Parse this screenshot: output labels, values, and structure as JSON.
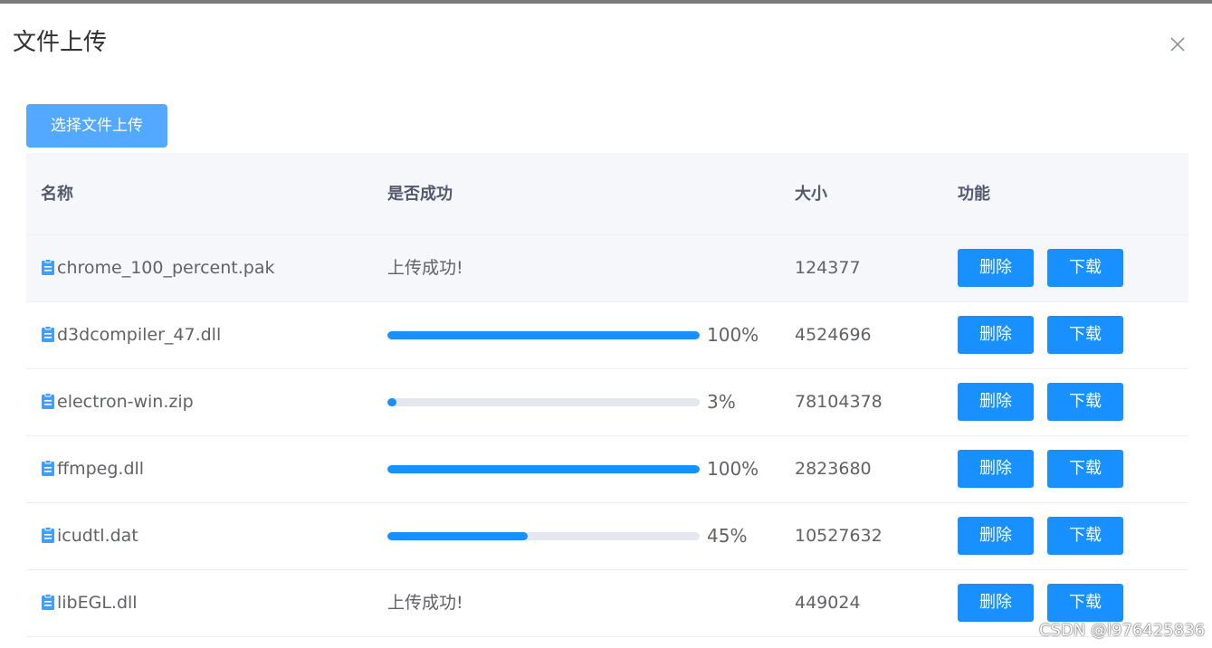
{
  "dialog": {
    "title": "文件上传"
  },
  "toolbar": {
    "upload_label": "选择文件上传"
  },
  "table": {
    "headers": {
      "name": "名称",
      "status": "是否成功",
      "size": "大小",
      "actions": "功能"
    },
    "rows": [
      {
        "name": "chrome_100_percent.pak",
        "status_type": "text",
        "status_text": "上传成功!",
        "size": "124377",
        "delete_label": "删除",
        "download_label": "下载"
      },
      {
        "name": "d3dcompiler_47.dll",
        "status_type": "progress",
        "progress": 100,
        "progress_text": "100%",
        "size": "4524696",
        "delete_label": "删除",
        "download_label": "下载"
      },
      {
        "name": "electron-win.zip",
        "status_type": "progress",
        "progress": 3,
        "progress_text": "3%",
        "size": "78104378",
        "delete_label": "删除",
        "download_label": "下载"
      },
      {
        "name": "ffmpeg.dll",
        "status_type": "progress",
        "progress": 100,
        "progress_text": "100%",
        "size": "2823680",
        "delete_label": "删除",
        "download_label": "下载"
      },
      {
        "name": "icudtl.dat",
        "status_type": "progress",
        "progress": 45,
        "progress_text": "45%",
        "size": "10527632",
        "delete_label": "删除",
        "download_label": "下载"
      },
      {
        "name": "libEGL.dll",
        "status_type": "text",
        "status_text": "上传成功!",
        "size": "449024",
        "delete_label": "删除",
        "download_label": "下载"
      }
    ]
  },
  "watermark": "CSDN @l976425836",
  "icons": {
    "close": "close-icon",
    "file": "document-icon"
  },
  "colors": {
    "primary": "#1890ff",
    "upload_button": "#53a8ff",
    "header_bg": "#f5f7fa"
  }
}
